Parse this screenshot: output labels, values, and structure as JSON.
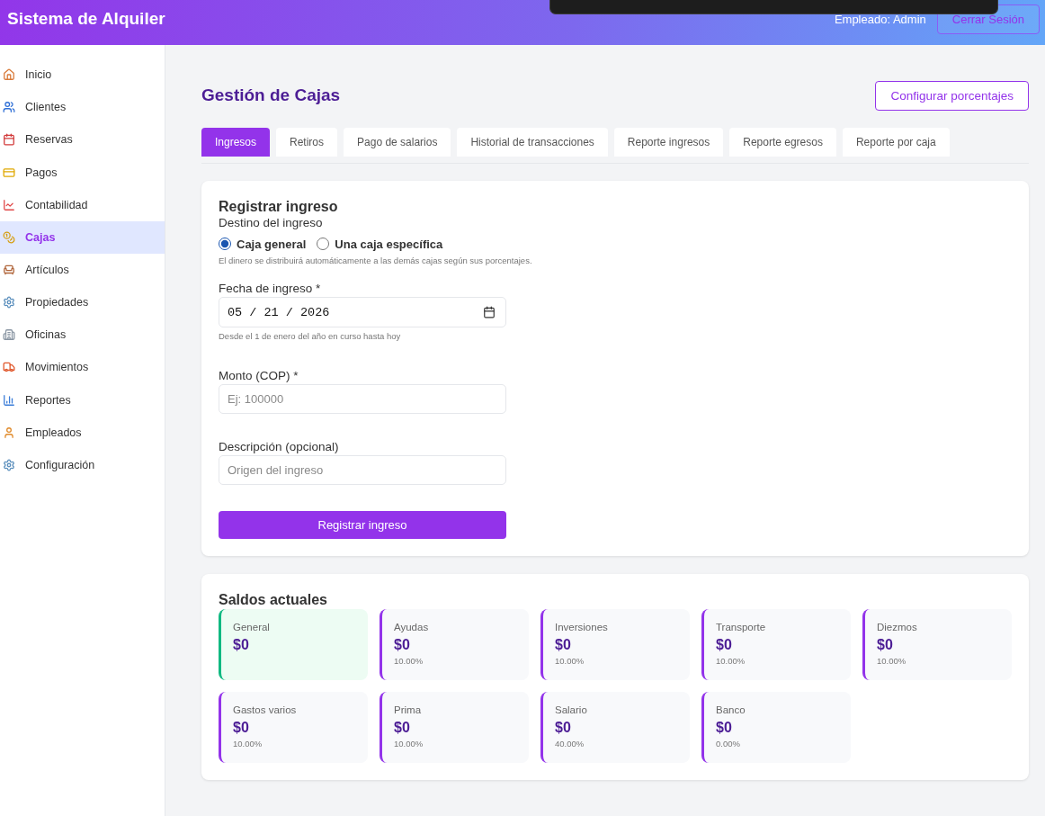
{
  "header": {
    "title": "Sistema de Alquiler",
    "user_label": "Empleado: Admin",
    "logout_button": "Cerrar Sesión"
  },
  "sidebar": {
    "items": [
      {
        "label": "Inicio",
        "selected": false
      },
      {
        "label": "Clientes",
        "selected": false
      },
      {
        "label": "Reservas",
        "selected": false
      },
      {
        "label": "Pagos",
        "selected": false
      },
      {
        "label": "Contabilidad",
        "selected": false
      },
      {
        "label": "Cajas",
        "selected": true
      },
      {
        "label": "Artículos",
        "selected": false
      },
      {
        "label": "Propiedades",
        "selected": false
      },
      {
        "label": "Oficinas",
        "selected": false
      },
      {
        "label": "Movimientos",
        "selected": false
      },
      {
        "label": "Reportes",
        "selected": false
      },
      {
        "label": "Empleados",
        "selected": false
      },
      {
        "label": "Configuración",
        "selected": false
      }
    ]
  },
  "page": {
    "title": "Gestión de Cajas",
    "action_button": "Configurar porcentajes"
  },
  "tabs": [
    {
      "label": "Ingresos",
      "selected": true
    },
    {
      "label": "Retiros",
      "selected": false
    },
    {
      "label": "Pago de salarios",
      "selected": false
    },
    {
      "label": "Historial de transacciones",
      "selected": false
    },
    {
      "label": "Reporte ingresos",
      "selected": false
    },
    {
      "label": "Reporte egresos",
      "selected": false
    },
    {
      "label": "Reporte por caja",
      "selected": false
    }
  ],
  "income_form": {
    "title": "Registrar ingreso",
    "destination": {
      "label": "Destino del ingreso",
      "options": [
        {
          "label": "Caja general",
          "selected": true
        },
        {
          "label": "Una caja específica",
          "selected": false
        }
      ],
      "hint": "El dinero se distribuirá automáticamente a las demás cajas según sus porcentajes."
    },
    "date": {
      "label": "Fecha de ingreso *",
      "value": "05 / 21 / 2026",
      "hint": "Desde el 1 de enero del año en curso hasta hoy"
    },
    "amount": {
      "label": "Monto (COP) *",
      "placeholder": "Ej: 100000"
    },
    "description": {
      "label": "Descripción (opcional)",
      "placeholder": "Origen del ingreso"
    },
    "submit_button": "Registrar ingreso"
  },
  "balances": {
    "title": "Saldos actuales",
    "items": [
      {
        "name": "General",
        "amount": "$0",
        "selected": true
      },
      {
        "name": "Ayudas",
        "amount": "$0",
        "percent": "10.00%",
        "selected": false
      },
      {
        "name": "Inversiones",
        "amount": "$0",
        "percent": "10.00%",
        "selected": false
      },
      {
        "name": "Transporte",
        "amount": "$0",
        "percent": "10.00%",
        "selected": false
      },
      {
        "name": "Diezmos",
        "amount": "$0",
        "percent": "10.00%",
        "selected": false
      },
      {
        "name": "Gastos varios",
        "amount": "$0",
        "percent": "10.00%",
        "selected": false
      },
      {
        "name": "Prima",
        "amount": "$0",
        "percent": "10.00%",
        "selected": false
      },
      {
        "name": "Salario",
        "amount": "$0",
        "percent": "40.00%",
        "selected": false
      },
      {
        "name": "Banco",
        "amount": "$0",
        "percent": "0.00%",
        "selected": false
      }
    ]
  }
}
